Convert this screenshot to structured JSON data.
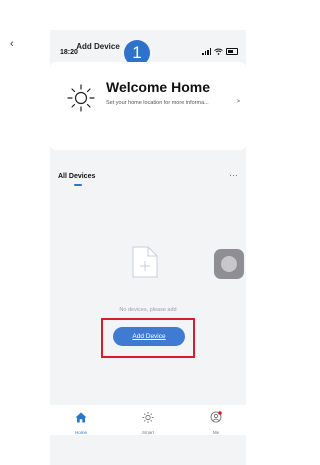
{
  "status_bar": {
    "time": "18:20"
  },
  "nav": {
    "title": "Add Device",
    "step": "1"
  },
  "welcome": {
    "title": "Welcome Home",
    "subtitle": "Set your home location for more informa...",
    "chevron": ">"
  },
  "devices": {
    "tab_label": "All Devices",
    "more": "···",
    "empty_text": "No devices, please add",
    "add_button": "Add Device"
  },
  "tabs": [
    {
      "label": "Home",
      "icon": "home-icon",
      "active": true
    },
    {
      "label": "Smart",
      "icon": "sun-icon",
      "active": false
    },
    {
      "label": "Me",
      "icon": "user-icon",
      "active": false
    }
  ],
  "colors": {
    "accent": "#2e73c9",
    "button": "#3f7bd3",
    "highlight": "#d51e2c",
    "background": "#f3f4f6"
  }
}
